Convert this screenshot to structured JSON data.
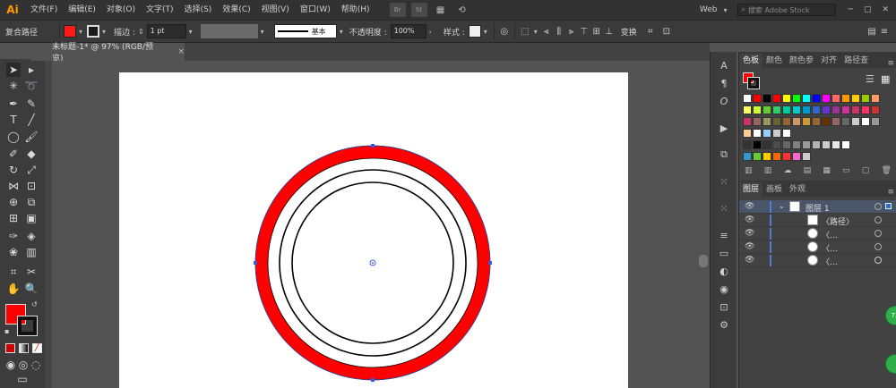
{
  "app": {
    "logo": "Ai"
  },
  "menu": [
    "文件(F)",
    "编辑(E)",
    "对象(O)",
    "文字(T)",
    "选择(S)",
    "效果(C)",
    "视图(V)",
    "窗口(W)",
    "帮助(H)"
  ],
  "menubar_icons": {
    "br": "Br",
    "st": "St"
  },
  "workspace": {
    "label": "Web",
    "search_placeholder": "搜索 Adobe Stock"
  },
  "control": {
    "selection_label": "复合路径",
    "fill_color": "#ff1a1a",
    "stroke_label": "描边 :",
    "stroke_weight": "1 pt",
    "brush_label": "基本",
    "opacity_label": "不透明度 :",
    "opacity_value": "100%",
    "style_label": "样式 :",
    "transform_label": "变换"
  },
  "document": {
    "tab_title": "未标题-1* @ 97% (RGB/预览)",
    "close": "×"
  },
  "colors": {
    "fill": "#ff0000",
    "ring_red": "#ff0000",
    "selection": "#3a5bd9",
    "accent_layer": "#4e7fd6"
  },
  "swatches_panel": {
    "tabs": [
      "色板",
      "颜色",
      "颜色参",
      "对齐",
      "路径查"
    ],
    "rows": [
      [
        "#ffffff",
        "#ff0000",
        "#000000",
        "#ff0000",
        "#ffff00",
        "#00ff00",
        "#00ffff",
        "#0000ff",
        "#ff00ff",
        "#ff6666",
        "#ff9900",
        "#ffcc00",
        "#99cc00",
        "#ff9966"
      ],
      [
        "#ffff66",
        "#ccff33",
        "#66cc33",
        "#33cc66",
        "#00cc99",
        "#00cccc",
        "#0099cc",
        "#3366cc",
        "#6633cc",
        "#993399",
        "#cc3399",
        "#cc3366",
        "#ff3366",
        "#cc3333"
      ],
      [
        "#cc3366",
        "#996666",
        "#999966",
        "#666633",
        "#996633",
        "#cc9966",
        "#cc9933",
        "#996633",
        "#663300",
        "#996666",
        "#666666",
        "#cccccc",
        "#ffffff",
        "#999999"
      ],
      [
        "#ffcc99",
        "#ffffff",
        "#99ccff",
        "#cccccc",
        "#ffffff"
      ],
      [
        "#333333",
        "#000000",
        "#333333",
        "#4d4d4d",
        "#666666",
        "#808080",
        "#999999",
        "#b3b3b3",
        "#cccccc",
        "#e6e6e6",
        "#ffffff"
      ],
      [
        "#3399cc",
        "#66cc33",
        "#ffcc00",
        "#ff6600",
        "#ff3333",
        "#ff66cc",
        "#cccccc"
      ]
    ]
  },
  "layers_panel": {
    "tabs": [
      "图层",
      "画板",
      "外观"
    ],
    "rows": [
      {
        "name": "图层 1",
        "indent": false
      },
      {
        "name": "〈路径〉",
        "indent": true
      },
      {
        "name": "〈...",
        "indent": true
      },
      {
        "name": "〈...",
        "indent": true
      },
      {
        "name": "〈...",
        "indent": true
      }
    ]
  },
  "badges": [
    "72",
    ""
  ]
}
